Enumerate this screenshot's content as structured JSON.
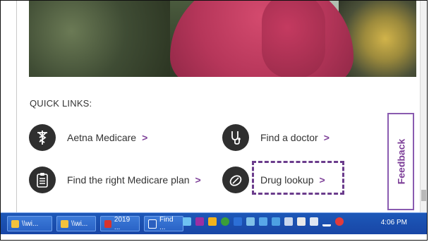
{
  "quick_links": {
    "title": "QUICK LINKS:",
    "items": [
      {
        "label": "Aetna Medicare",
        "icon": "caduceus-icon"
      },
      {
        "label": "Find a doctor",
        "icon": "stethoscope-icon"
      },
      {
        "label": "Find the right Medicare plan",
        "icon": "clipboard-icon"
      },
      {
        "label": "Drug lookup",
        "icon": "pill-icon"
      }
    ],
    "chevron": ">"
  },
  "feedback": {
    "label": "Feedback"
  },
  "taskbar": {
    "buttons": [
      {
        "label": "\\\\wi...",
        "icon": "folder-icon"
      },
      {
        "label": "\\\\wi...",
        "icon": "folder-icon"
      },
      {
        "label": "2019 ...",
        "icon": "pdf-icon"
      },
      {
        "label": "Find ...",
        "icon": "word-icon"
      }
    ],
    "tray_icons": [
      "network-icon",
      "onenote-icon",
      "outlook-icon",
      "chrome-icon",
      "word-icon",
      "tool-icon",
      "onedrive-icon",
      "calendar-icon",
      "keyboard-icon",
      "printer-icon",
      "wifi-icon",
      "signal-icon",
      "volume-icon"
    ],
    "clock": "4:06 PM"
  },
  "colors": {
    "accent": "#7d3f98",
    "taskbar": "#1d58b8",
    "icon_bg": "#2f2f2f"
  }
}
